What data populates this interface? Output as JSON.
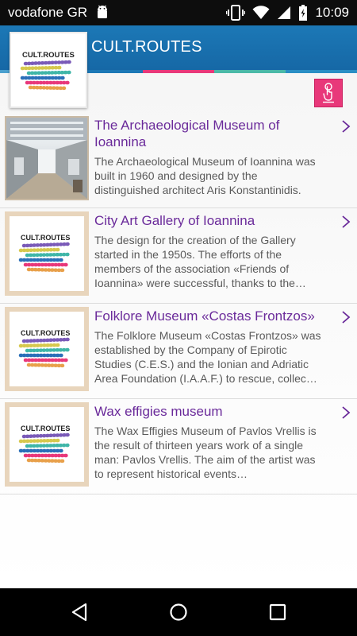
{
  "status_bar": {
    "carrier": "vodafone GR",
    "time": "10:09"
  },
  "app_bar": {
    "title": "CULT.ROUTES"
  },
  "logo": {
    "text": "CULT.ROUTES"
  },
  "accent_strip": [
    "#4ba0cf",
    "#1c78b6",
    "#e8387a",
    "#4bb9a8",
    "#2a8fc5",
    "#1c78b6"
  ],
  "list": [
    {
      "title": "The Archaeological Museum of Ioannina",
      "description": "The Archaeological Museum of Ioannina was built in 1960 and  designed by the distinguished architect Aris Konstantinidis.",
      "thumb": "museum-photo"
    },
    {
      "title": "City Art Gallery of Ioannina",
      "description": "The design for the creation of the Gallery started in the 1950s. The efforts of the members of the association «Friends of Ioannina» were successful, thanks to the…",
      "thumb": "cult-routes-logo"
    },
    {
      "title": "Folklore Museum «Costas Frontzos»",
      "description": "The Folklore Museum «Costas Frontzos» was established by the Company of Epirotic Studies (C.E.S.) and the Ionian and Adriatic Area Foundation (I.A.A.F.) to rescue, collec…",
      "thumb": "cult-routes-logo"
    },
    {
      "title": "Wax effigies museum",
      "description": "The  Wax Effigies Museum of Pavlos Vrellis is the result of thirteen years work of a single man: Pavlos Vrellis. The aim of the artist was to represent historical events…",
      "thumb": "cult-routes-logo"
    }
  ]
}
